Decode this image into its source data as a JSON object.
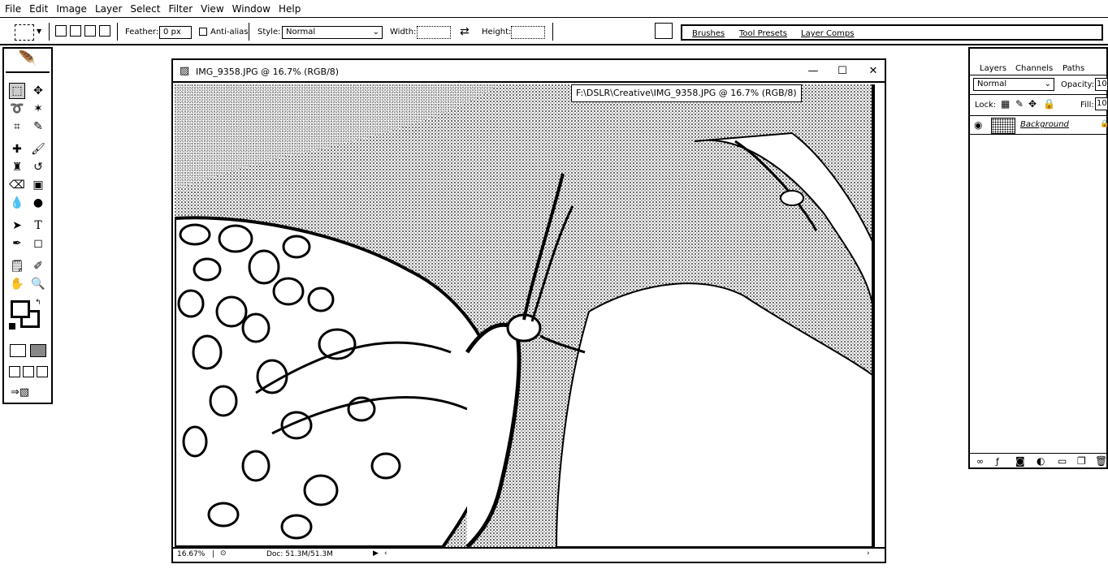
{
  "menu": [
    "File",
    "Edit",
    "Image",
    "Layer",
    "Select",
    "Filter",
    "View",
    "Window",
    "Help"
  ],
  "options": {
    "feather_label": "Feather:",
    "feather_value": "0 px",
    "antialias_label": "Anti-alias",
    "style_label": "Style:",
    "style_value": "Normal",
    "width_label": "Width:",
    "height_label": "Height:"
  },
  "palette_well": {
    "tabs": [
      "Brushes",
      "Tool Presets",
      "Layer Comps"
    ]
  },
  "toolbox": {
    "tools": [
      "marquee-icon",
      "move-icon",
      "lasso-icon",
      "magic-wand-icon",
      "crop-icon",
      "slice-icon",
      "healing-brush-icon",
      "brush-icon",
      "clone-stamp-icon",
      "history-brush-icon",
      "eraser-icon",
      "gradient-icon",
      "blur-icon",
      "dodge-icon",
      "path-select-icon",
      "type-icon",
      "pen-icon",
      "shape-icon",
      "notes-icon",
      "eyedropper-icon",
      "hand-icon",
      "zoom-icon"
    ]
  },
  "document": {
    "title": "IMG_9358.JPG @ 16.7% (RGB/8)",
    "tooltip": "F:\\DSLR\\Creative\\IMG_9358.JPG @ 16.7% (RGB/8)",
    "zoom": "16.67%",
    "doc_info": "Doc: 51.3M/51.3M"
  },
  "layers_panel": {
    "tabs": [
      "Layers",
      "Channels",
      "Paths"
    ],
    "blend_mode": "Normal",
    "opacity_label": "Opacity:",
    "opacity_value": "10",
    "lock_label": "Lock:",
    "fill_label": "Fill:",
    "fill_value": "10",
    "layer_name": "Background"
  }
}
